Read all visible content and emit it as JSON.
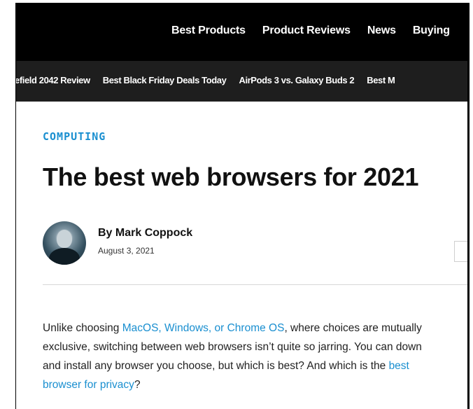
{
  "top_nav": {
    "items": [
      "Best Products",
      "Product Reviews",
      "News",
      "Buying"
    ]
  },
  "trending_nav": {
    "items": [
      "efield 2042 Review",
      "Best Black Friday Deals Today",
      "AirPods 3 vs. Galaxy Buds 2",
      "Best M"
    ]
  },
  "article": {
    "category": "COMPUTING",
    "headline": "The best web browsers for 2021",
    "author": "By Mark Coppock",
    "date": "August 3, 2021",
    "body": {
      "l1_text": "Unlike choosing ",
      "l1_link": "MacOS, Windows, or Chrome OS",
      "l1_tail": ", where choices are mutually",
      "l2": "exclusive, switching between web browsers isn’t quite so jarring. You can down",
      "l3_text": "and install any browser you choose, but which is best? And which is the ",
      "l3_link": "best",
      "l4_link": "browser for privacy",
      "l4_tail": "?"
    }
  },
  "colors": {
    "top_bar": "#000000",
    "trending_bar": "#1e1e1e",
    "accent": "#1a8fd0"
  }
}
